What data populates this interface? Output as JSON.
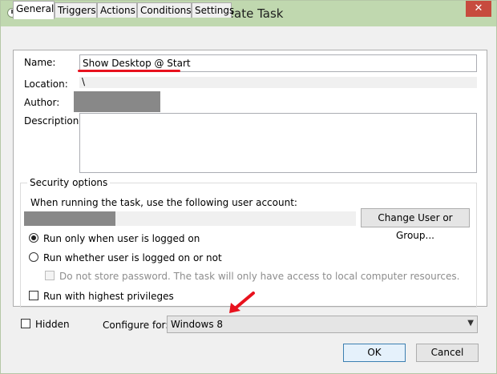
{
  "window": {
    "title": "Create Task",
    "close_glyph": "✕"
  },
  "tabs": [
    "General",
    "Triggers",
    "Actions",
    "Conditions",
    "Settings"
  ],
  "general": {
    "name_label": "Name:",
    "name_value": "Show Desktop @ Start",
    "location_label": "Location:",
    "location_value": "\\",
    "author_label": "Author:",
    "description_label": "Description:",
    "description_value": ""
  },
  "security": {
    "group_title": "Security options",
    "account_prompt": "When running the task, use the following user account:",
    "change_user_button": "Change User or Group...",
    "radio_logged_on": "Run only when user is logged on",
    "radio_logged_on_selected": true,
    "radio_whether": "Run whether user is logged on or not",
    "no_store_password": "Do not store password.  The task will only have access to local computer resources.",
    "highest_privileges": "Run with highest privileges"
  },
  "bottom": {
    "hidden_label": "Hidden",
    "configure_label": "Configure for:",
    "configure_value": "Windows 8"
  },
  "buttons": {
    "ok": "OK",
    "cancel": "Cancel"
  },
  "colors": {
    "titlebar": "#c0d8af",
    "close": "#c74b3e",
    "annotation_red": "#e8121e",
    "redacted_gray": "#888888"
  }
}
